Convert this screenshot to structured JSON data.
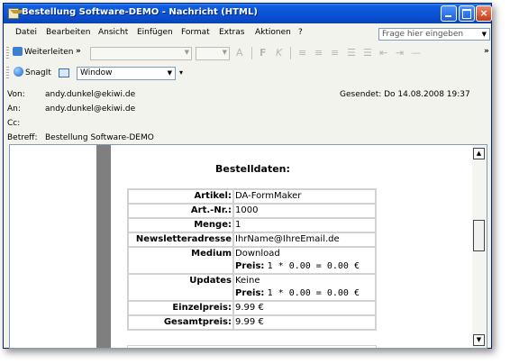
{
  "window": {
    "title": "Bestellung Software-DEMO - Nachricht (HTML)"
  },
  "menu": {
    "items": [
      "Datei",
      "Bearbeiten",
      "Ansicht",
      "Einfügen",
      "Format",
      "Extras",
      "Aktionen",
      "?"
    ],
    "help_placeholder": "Frage hier eingeben"
  },
  "toolbar1": {
    "forward_label": "Weiterleiten",
    "more": "»"
  },
  "toolbar2": {
    "snagit_label": "SnagIt",
    "window_combo": "Window"
  },
  "header": {
    "from_label": "Von:",
    "from": "andy.dunkel@ekiwi.de",
    "to_label": "An:",
    "to": "andy.dunkel@ekiwi.de",
    "cc_label": "Cc:",
    "subject_label": "Betreff:",
    "subject": "Bestellung Software-DEMO",
    "sent": "Gesendet: Do 14.08.2008 19:37"
  },
  "order": {
    "title": "Bestelldaten:",
    "rows": [
      {
        "key": "Artikel:",
        "value": "DA-FormMaker"
      },
      {
        "key": "Art.-Nr.:",
        "value": "1000"
      },
      {
        "key": "Menge:",
        "value": "1"
      },
      {
        "key": "Newsletteradresse",
        "value": "IhrName@IhreEmail.de"
      },
      {
        "key": "Medium",
        "value": "Download",
        "price_label": "Preis:",
        "price": "1 * 0.00 = 0.00 €"
      },
      {
        "key": "Updates",
        "value": "Keine",
        "price_label": "Preis:",
        "price": "1 * 0.00 = 0.00 €"
      },
      {
        "key": "Einzelpreis:",
        "value": "9.99 €"
      },
      {
        "key": "Gesamtpreis:",
        "value": "9.99 €"
      }
    ]
  }
}
